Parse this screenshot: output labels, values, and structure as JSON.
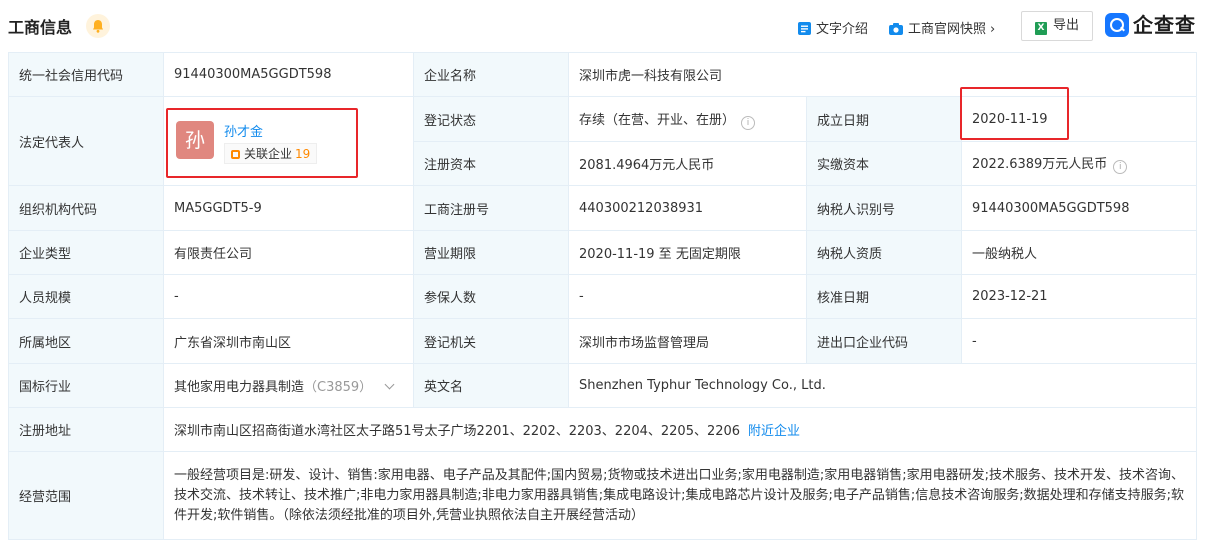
{
  "header": {
    "title": "工商信息",
    "text_intro": "文字介绍",
    "snapshot": "工商官网快照",
    "export": "导出",
    "export_icon": "X",
    "logo_text": "企查查"
  },
  "colors": {
    "accent": "#128bed",
    "label_bg": "#f2f9fc",
    "border": "#e4eef6",
    "highlight_box": "#e8262a",
    "tag_count": "#ff8900"
  },
  "rows": {
    "credit_code": {
      "label": "统一社会信用代码",
      "value": "91440300MA5GGDT598"
    },
    "company_name": {
      "label": "企业名称",
      "value": "深圳市虎一科技有限公司"
    },
    "legal_rep": {
      "label": "法定代表人",
      "avatar_char": "孙",
      "name": "孙才金",
      "tag_label": "关联企业",
      "tag_count": "19"
    },
    "reg_status": {
      "label": "登记状态",
      "value": "存续（在营、开业、在册）"
    },
    "founded": {
      "label": "成立日期",
      "value": "2020-11-19"
    },
    "reg_capital": {
      "label": "注册资本",
      "value": "2081.4964万元人民币"
    },
    "paid_capital": {
      "label": "实缴资本",
      "value": "2022.6389万元人民币"
    },
    "org_code": {
      "label": "组织机构代码",
      "value": "MA5GGDT5-9"
    },
    "reg_no": {
      "label": "工商注册号",
      "value": "440300212038931"
    },
    "taxpayer_id": {
      "label": "纳税人识别号",
      "value": "91440300MA5GGDT598"
    },
    "company_type": {
      "label": "企业类型",
      "value": "有限责任公司"
    },
    "term": {
      "label": "营业期限",
      "value": "2020-11-19 至 无固定期限"
    },
    "taxpayer_qual": {
      "label": "纳税人资质",
      "value": "一般纳税人"
    },
    "staff_size": {
      "label": "人员规模",
      "value": "-"
    },
    "insured": {
      "label": "参保人数",
      "value": "-"
    },
    "approval_date": {
      "label": "核准日期",
      "value": "2023-12-21"
    },
    "region": {
      "label": "所属地区",
      "value": "广东省深圳市南山区"
    },
    "authority": {
      "label": "登记机关",
      "value": "深圳市市场监督管理局"
    },
    "ie_code": {
      "label": "进出口企业代码",
      "value": "-"
    },
    "industry": {
      "label": "国标行业",
      "value": "其他家用电力器具制造",
      "code": "（C3859）"
    },
    "english_name": {
      "label": "英文名",
      "value": "Shenzhen Typhur Technology Co., Ltd."
    },
    "address": {
      "label": "注册地址",
      "value": "深圳市南山区招商街道水湾社区太子路51号太子广场2201、2202、2203、2204、2205、2206",
      "nearby": "附近企业"
    },
    "scope": {
      "label": "经营范围",
      "value": "一般经营项目是:研发、设计、销售:家用电器、电子产品及其配件;国内贸易;货物或技术进出口业务;家用电器制造;家用电器销售;家用电器研发;技术服务、技术开发、技术咨询、技术交流、技术转让、技术推广;非电力家用器具制造;非电力家用器具销售;集成电路设计;集成电路芯片设计及服务;电子产品销售;信息技术咨询服务;数据处理和存储支持服务;软件开发;软件销售。（除依法须经批准的项目外,凭营业执照依法自主开展经营活动）"
    }
  }
}
